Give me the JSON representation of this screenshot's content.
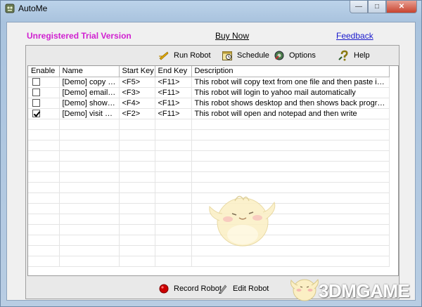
{
  "window": {
    "title": "AutoMe"
  },
  "header": {
    "trial_text": "Unregistered Trial Version",
    "buy_now": "Buy Now",
    "feedback": "Feedback"
  },
  "toolbar": {
    "run_robot": "Run Robot",
    "schedule": "Schedule",
    "options": "Options",
    "help": "Help"
  },
  "table": {
    "columns": [
      "Enable",
      "Name",
      "Start Key",
      "End Key",
      "Description"
    ],
    "rows": [
      {
        "enabled": false,
        "name": "[Demo] copy pa...",
        "start_key": "<F5>",
        "end_key": "<F11>",
        "description": "This robot will copy text from one file and then paste it to another f..."
      },
      {
        "enabled": false,
        "name": "[Demo] email login",
        "start_key": "<F3>",
        "end_key": "<F11>",
        "description": "This robot will login to yahoo mail automatically"
      },
      {
        "enabled": false,
        "name": "[Demo] show de...",
        "start_key": "<F4>",
        "end_key": "<F11>",
        "description": "This robot shows desktop and then shows back programs. It is cr..."
      },
      {
        "enabled": true,
        "name": "[Demo] visit web",
        "start_key": "<F2>",
        "end_key": "<F11>",
        "description": "This robot will open and notepad and then write"
      }
    ]
  },
  "bottombar": {
    "record_robot": "Record Robot",
    "edit_robot": "Edit Robot"
  },
  "watermark": {
    "text": "3DMGAME"
  },
  "colors": {
    "trial": "#d020d0",
    "feedback": "#1a1acc",
    "record": "#cc0000"
  }
}
